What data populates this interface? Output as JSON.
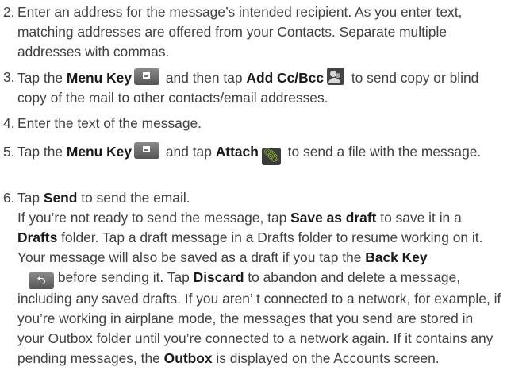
{
  "steps": [
    {
      "num": "2.",
      "text": "Enter an address for the message’s intended recipient. As you enter text, matching addresses are offered from your Contacts. Separate multiple addresses with commas."
    },
    {
      "num": "3.",
      "t1": "Tap the ",
      "b1": "Menu Key",
      "t2": " and then tap ",
      "b2": "Add Cc/Bcc",
      "t3": " to send copy or blind copy of the mail to other contacts/email addresses."
    },
    {
      "num": "4.",
      "text": "Enter the text of the message."
    },
    {
      "num": "5.",
      "t1": "Tap the ",
      "b1": "Menu Key",
      "t2": " and tap ",
      "b2": "Attach",
      "t3": " to send a file with the message."
    },
    {
      "num": "6.",
      "t1": "Tap ",
      "b1": "Send",
      "t2": " to send the email."
    }
  ],
  "note": {
    "t1": "If you’re not ready to send the message, tap ",
    "b1": "Save as draft",
    "t2": " to save it in a ",
    "b2": "Drafts",
    "t3": " folder. Tap a draft message in a Drafts folder to resume working on it. Your message will also be saved as a draft if you tap the ",
    "b3": "Back Key",
    "t4": " before sending it. Tap ",
    "b4": "Discard",
    "t5": " to abandon and delete a message, including any saved drafts. If you aren’ t connected to a network, for example, if you’re working in airplane mode, the messages that you send are stored in your Outbox folder until you’re connected to a network again. If it contains any pending messages, the ",
    "b5": "Outbox",
    "t6": " is displayed on the Accounts screen."
  },
  "icons": {
    "menu_key": "menu-key-icon",
    "add_cc_bcc": "contacts-icon",
    "attach": "paperclip-icon",
    "back_key": "back-arrow-icon"
  }
}
